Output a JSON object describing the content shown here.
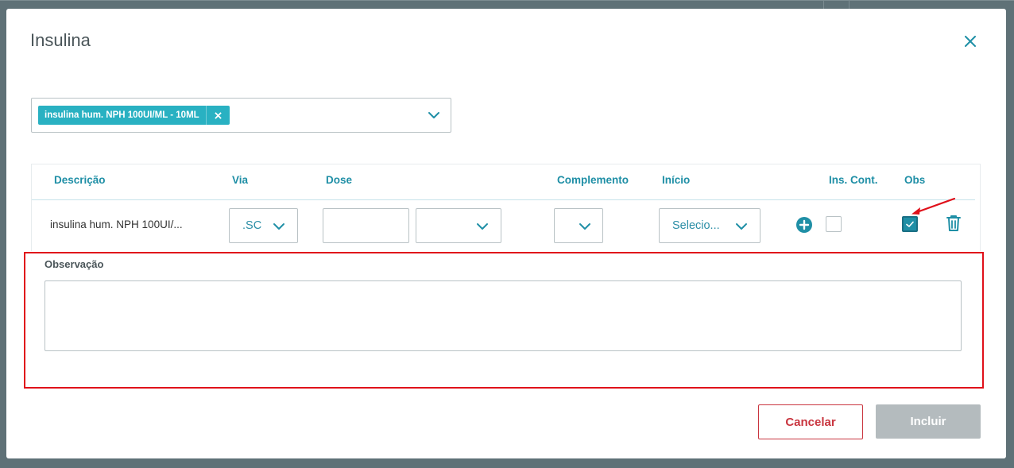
{
  "modal": {
    "title": "Insulina",
    "close_icon": "close-icon"
  },
  "selector": {
    "tag_label": "insulina hum. NPH 100UI/ML - 10ML",
    "tag_remove_icon": "close-icon",
    "dropdown_icon": "chevron-down-icon"
  },
  "grid": {
    "headers": {
      "descricao": "Descrição",
      "via": "Via",
      "dose": "Dose",
      "complemento": "Complemento",
      "inicio": "Início",
      "ins_cont": "Ins. Cont.",
      "obs": "Obs"
    },
    "row": {
      "descricao": "insulina hum. NPH 100UI/...",
      "via": ".SC",
      "dose_value": "",
      "dose_unit": "",
      "complemento": "",
      "inicio": "Selecio...",
      "ins_cont_checked": false,
      "obs_checked": true
    }
  },
  "observacao": {
    "label": "Observação",
    "value": ""
  },
  "footer": {
    "cancel_label": "Cancelar",
    "submit_label": "Incluir"
  },
  "colors": {
    "accent": "#1f8fa6",
    "tag": "#29b1c2",
    "cancel": "#c9353f",
    "disabled": "#b4bbbe",
    "annotation": "#e0101a"
  }
}
